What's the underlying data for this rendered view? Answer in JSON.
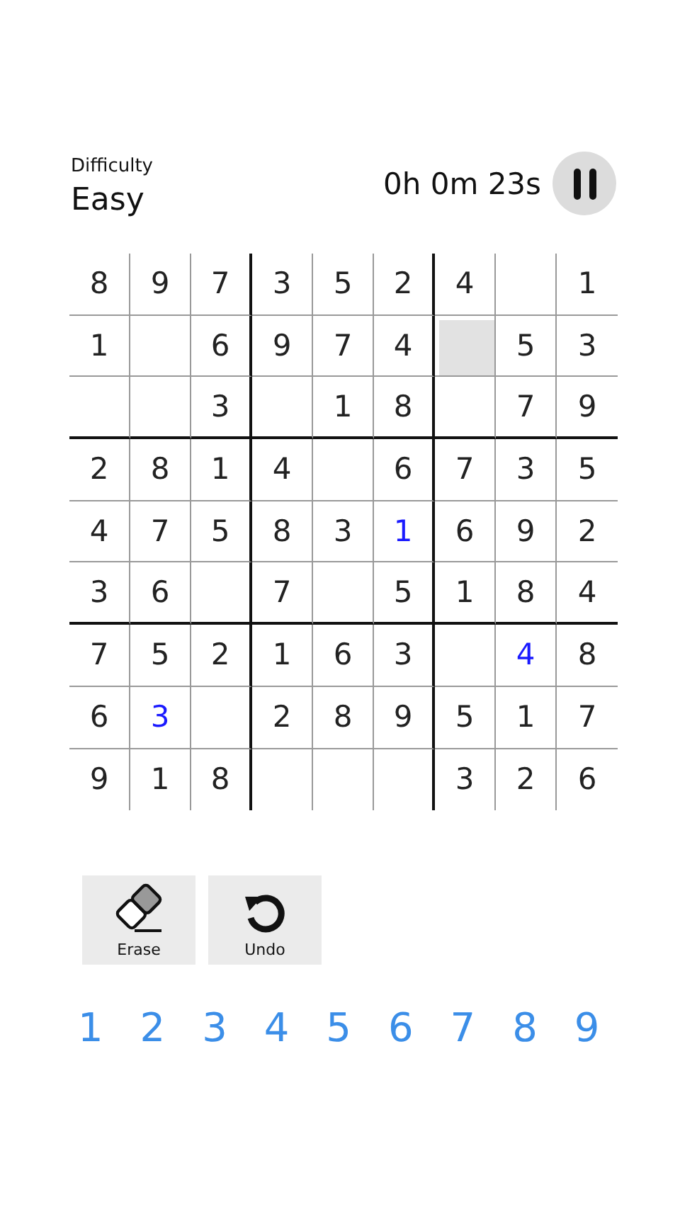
{
  "header": {
    "difficulty_label": "Difficulty",
    "difficulty": "Easy",
    "timer": "0h 0m 23s",
    "paused": false
  },
  "grid": {
    "rows": [
      [
        {
          "value": "8",
          "given": true,
          "selected": false
        },
        {
          "value": "9",
          "given": true,
          "selected": false
        },
        {
          "value": "7",
          "given": true,
          "selected": false
        },
        {
          "value": "3",
          "given": true,
          "selected": false
        },
        {
          "value": "5",
          "given": true,
          "selected": false
        },
        {
          "value": "2",
          "given": true,
          "selected": false
        },
        {
          "value": "4",
          "given": true,
          "selected": false
        },
        {
          "selected": false
        },
        {
          "value": "1",
          "given": true,
          "selected": false
        }
      ],
      [
        {
          "value": "1",
          "given": true,
          "selected": false
        },
        {
          "selected": false
        },
        {
          "value": "6",
          "given": true,
          "selected": false
        },
        {
          "value": "9",
          "given": true,
          "selected": false
        },
        {
          "value": "7",
          "given": true,
          "selected": false
        },
        {
          "value": "4",
          "given": true,
          "selected": false
        },
        {
          "selected": true
        },
        {
          "value": "5",
          "given": true,
          "selected": false
        },
        {
          "value": "3",
          "given": true,
          "selected": false
        }
      ],
      [
        {
          "selected": false
        },
        {
          "selected": false
        },
        {
          "value": "3",
          "given": true,
          "selected": false
        },
        {
          "selected": false
        },
        {
          "value": "1",
          "given": true,
          "selected": false
        },
        {
          "value": "8",
          "given": true,
          "selected": false
        },
        {
          "selected": false
        },
        {
          "value": "7",
          "given": true,
          "selected": false
        },
        {
          "value": "9",
          "given": true,
          "selected": false
        }
      ],
      [
        {
          "value": "2",
          "given": true,
          "selected": false
        },
        {
          "value": "8",
          "given": true,
          "selected": false
        },
        {
          "value": "1",
          "given": true,
          "selected": false
        },
        {
          "value": "4",
          "given": true,
          "selected": false
        },
        {
          "selected": false
        },
        {
          "value": "6",
          "given": true,
          "selected": false
        },
        {
          "value": "7",
          "given": true,
          "selected": false
        },
        {
          "value": "3",
          "given": true,
          "selected": false
        },
        {
          "value": "5",
          "given": true,
          "selected": false
        }
      ],
      [
        {
          "value": "4",
          "given": true,
          "selected": false
        },
        {
          "value": "7",
          "given": true,
          "selected": false
        },
        {
          "value": "5",
          "given": true,
          "selected": false
        },
        {
          "value": "8",
          "given": true,
          "selected": false
        },
        {
          "value": "3",
          "given": true,
          "selected": false
        },
        {
          "value": "1",
          "given": false,
          "selected": false
        },
        {
          "value": "6",
          "given": true,
          "selected": false
        },
        {
          "value": "9",
          "given": true,
          "selected": false
        },
        {
          "value": "2",
          "given": true,
          "selected": false
        }
      ],
      [
        {
          "value": "3",
          "given": true,
          "selected": false
        },
        {
          "value": "6",
          "given": true,
          "selected": false
        },
        {
          "selected": false
        },
        {
          "value": "7",
          "given": true,
          "selected": false
        },
        {
          "selected": false
        },
        {
          "value": "5",
          "given": true,
          "selected": false
        },
        {
          "value": "1",
          "given": true,
          "selected": false
        },
        {
          "value": "8",
          "given": true,
          "selected": false
        },
        {
          "value": "4",
          "given": true,
          "selected": false
        }
      ],
      [
        {
          "value": "7",
          "given": true,
          "selected": false
        },
        {
          "value": "5",
          "given": true,
          "selected": false
        },
        {
          "value": "2",
          "given": true,
          "selected": false
        },
        {
          "value": "1",
          "given": true,
          "selected": false
        },
        {
          "value": "6",
          "given": true,
          "selected": false
        },
        {
          "value": "3",
          "given": true,
          "selected": false
        },
        {
          "selected": false
        },
        {
          "value": "4",
          "given": false,
          "selected": false
        },
        {
          "value": "8",
          "given": true,
          "selected": false
        }
      ],
      [
        {
          "value": "6",
          "given": true,
          "selected": false
        },
        {
          "value": "3",
          "given": false,
          "selected": false
        },
        {
          "selected": false
        },
        {
          "value": "2",
          "given": true,
          "selected": false
        },
        {
          "value": "8",
          "given": true,
          "selected": false
        },
        {
          "value": "9",
          "given": true,
          "selected": false
        },
        {
          "value": "5",
          "given": true,
          "selected": false
        },
        {
          "value": "1",
          "given": true,
          "selected": false
        },
        {
          "value": "7",
          "given": true,
          "selected": false
        }
      ],
      [
        {
          "value": "9",
          "given": true,
          "selected": false
        },
        {
          "value": "1",
          "given": true,
          "selected": false
        },
        {
          "value": "8",
          "given": true,
          "selected": false
        },
        {
          "selected": false
        },
        {
          "selected": false
        },
        {
          "selected": false
        },
        {
          "value": "3",
          "given": true,
          "selected": false
        },
        {
          "value": "2",
          "given": true,
          "selected": false
        },
        {
          "value": "6",
          "given": true,
          "selected": false
        }
      ]
    ]
  },
  "tools": [
    {
      "kind": "erase",
      "label": "Erase"
    },
    {
      "kind": "undo",
      "label": "Undo"
    }
  ],
  "number_pad": [
    "1",
    "2",
    "3",
    "4",
    "5",
    "6",
    "7",
    "8",
    "9"
  ]
}
